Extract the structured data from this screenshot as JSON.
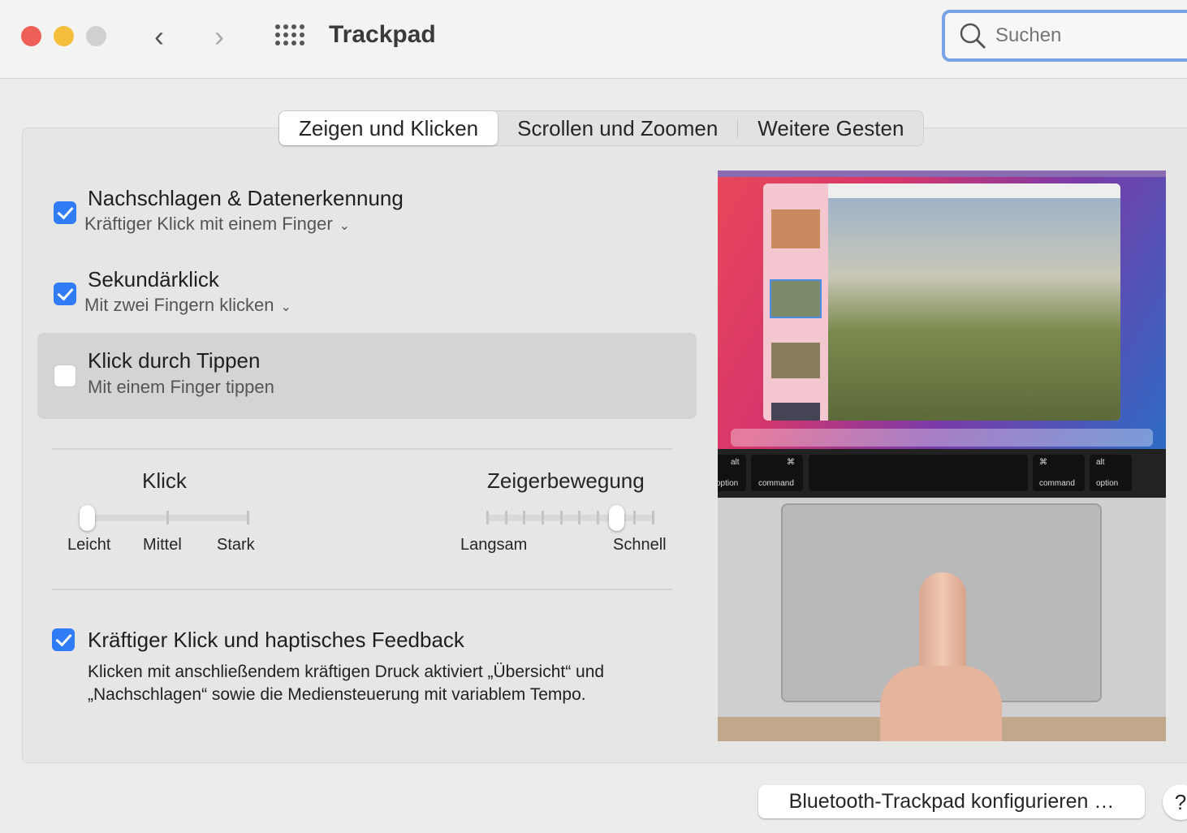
{
  "window": {
    "title": "Trackpad",
    "search_placeholder": "Suchen"
  },
  "tabs": [
    "Zeigen und Klicken",
    "Scrollen und Zoomen",
    "Weitere Gesten"
  ],
  "options": [
    {
      "title": "Nachschlagen & Datenerkennung",
      "sub": "Kräftiger Klick mit einem Finger",
      "checked": true
    },
    {
      "title": "Sekundärklick",
      "sub": "Mit zwei Fingern klicken",
      "checked": true
    },
    {
      "title": "Klick durch Tippen",
      "sub": "Mit einem Finger tippen",
      "checked": false
    }
  ],
  "click_slider": {
    "label": "Klick",
    "ticks": [
      "Leicht",
      "Mittel",
      "Stark"
    ],
    "value_index": 0,
    "steps": 3
  },
  "pointer_slider": {
    "label": "Zeigerbewegung",
    "min_label": "Langsam",
    "max_label": "Schnell",
    "value_index": 7,
    "steps": 10
  },
  "force_click": {
    "title": "Kräftiger Klick und haptisches Feedback",
    "checked": true,
    "desc": "Klicken mit anschließendem kräftigen Druck aktiviert „Übersicht“ und „Nachschlagen“ sowie die Mediensteuerung mit variablem Tempo."
  },
  "illustration": {
    "keys": [
      "alt",
      "option",
      "command",
      "command",
      "alt",
      "option"
    ],
    "symbol": "⌘"
  },
  "footer": {
    "bluetooth_button": "Bluetooth-Trackpad konfigurieren …",
    "help": "?"
  },
  "colors": {
    "accent": "#2f7cf6"
  }
}
